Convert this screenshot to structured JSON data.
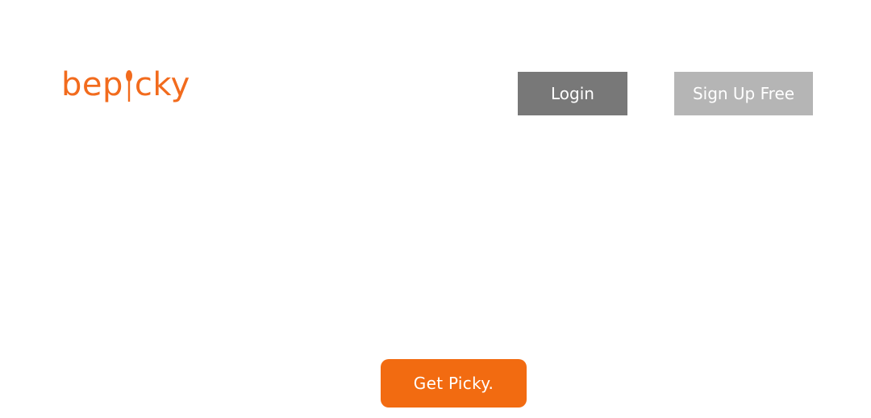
{
  "header": {
    "logo_prefix": "bep",
    "logo_suffix": "cky",
    "login_label": "Login",
    "signup_label": "Sign Up Free"
  },
  "hero": {
    "cta_label": "Get Picky."
  },
  "colors": {
    "brand": "#f26b1d",
    "login_bg": "#787878",
    "signup_bg": "#b5b5b5",
    "cta_bg": "#f26b11"
  },
  "icons": {
    "logo_i": "spoon-icon"
  }
}
